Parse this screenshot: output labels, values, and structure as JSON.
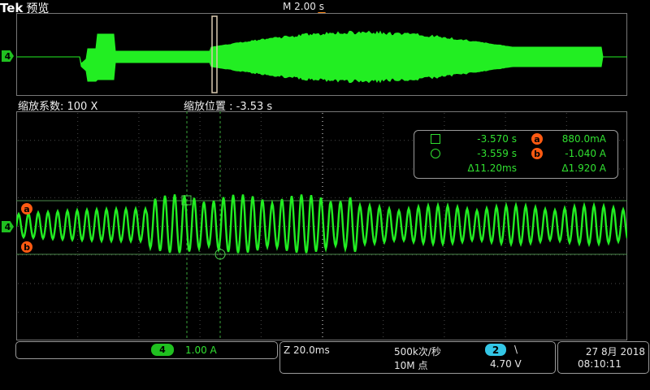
{
  "header": {
    "brand": "Tek",
    "brand_sub": "预览",
    "timebase": "M 2.00 s"
  },
  "channel_marker": "4",
  "zoom": {
    "factor_label": "缩放系数: 100 X",
    "position_label": "缩放位置 : -3.53 s"
  },
  "cursors": {
    "a_label": "a",
    "b_label": "b",
    "square_time": "-3.570 s",
    "circle_time": "-3.559 s",
    "delta_time": "Δ11.20ms",
    "a_value": "880.0mA",
    "b_value": "-1.040 A",
    "delta_value": "Δ1.920 A"
  },
  "status": {
    "ch4_badge": "4",
    "ch4_scale": "1.00 A",
    "zoom_time": "Z 20.0ms",
    "sample_rate": "500k次/秒",
    "record_length": "10M 点",
    "trigger_channel": "2",
    "trigger_slope": "\\",
    "trigger_level": "4.70 V",
    "date": "27 8月 2018",
    "time": "08:10:11"
  },
  "colors": {
    "trace": "#22ee22",
    "cursor": "#ff5a12",
    "ch2": "#33c6e6",
    "grid": "#555555"
  }
}
